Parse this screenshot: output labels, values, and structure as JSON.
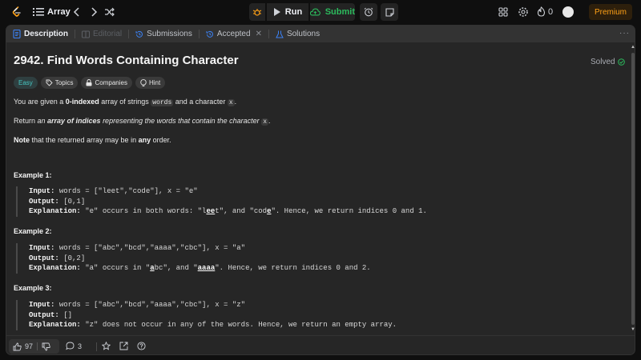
{
  "nav": {
    "title": "Array",
    "run_label": "Run",
    "submit_label": "Submit",
    "streak_count": "0",
    "premium_label": "Premium"
  },
  "tabs": [
    {
      "label": "Description"
    },
    {
      "label": "Editorial"
    },
    {
      "label": "Submissions"
    },
    {
      "label": "Accepted"
    },
    {
      "label": "Solutions"
    }
  ],
  "tabs_more": "···",
  "problem": {
    "title": "2942. Find Words Containing Character",
    "status": "Solved",
    "tags": [
      "Easy",
      "Topics",
      "Companies",
      "Hint"
    ],
    "p1": {
      "a": "You are given a ",
      "b": "0-indexed",
      "c": " array of strings ",
      "code1": "words",
      "d": " and a character ",
      "code2": "x",
      "e": "."
    },
    "p2": {
      "a": "Return ",
      "b": "an ",
      "c": "array of indices",
      "d": " representing the words that contain the character ",
      "code": "x",
      "e": "."
    },
    "p3": {
      "a": "Note",
      "b": " that the returned array may be in ",
      "c": "any",
      "d": " order."
    }
  },
  "examples": [
    {
      "heading": "Example 1:",
      "input": "words = [\"leet\",\"code\"], x = \"e\"",
      "output": "[0,1]",
      "expl_a": "\"e\" occurs in both words: \"l",
      "expl_u1": "ee",
      "expl_b": "t\", and \"cod",
      "expl_u2": "e",
      "expl_c": "\". Hence, we return indices 0 and 1."
    },
    {
      "heading": "Example 2:",
      "input": "words = [\"abc\",\"bcd\",\"aaaa\",\"cbc\"], x = \"a\"",
      "output": "[0,2]",
      "expl_a": "\"a\" occurs in \"",
      "expl_u1": "a",
      "expl_b": "bc\", and \"",
      "expl_u2": "aaaa",
      "expl_c": "\". Hence, we return indices 0 and 2."
    },
    {
      "heading": "Example 3:",
      "input": "words = [\"abc\",\"bcd\",\"aaaa\",\"cbc\"], x = \"z\"",
      "output": "[]",
      "expl": "\"z\" does not occur in any of the words. Hence, we return an empty array."
    }
  ],
  "labels": {
    "input": "Input:",
    "output": "Output:",
    "explanation": "Explanation:"
  },
  "footer": {
    "likes": "97",
    "comments": "3"
  },
  "colors": {
    "accent": "#ffa116",
    "green": "#2cbb5d",
    "easy": "#46c6c2",
    "panel": "#262626",
    "bg": "#0f0f0f"
  }
}
